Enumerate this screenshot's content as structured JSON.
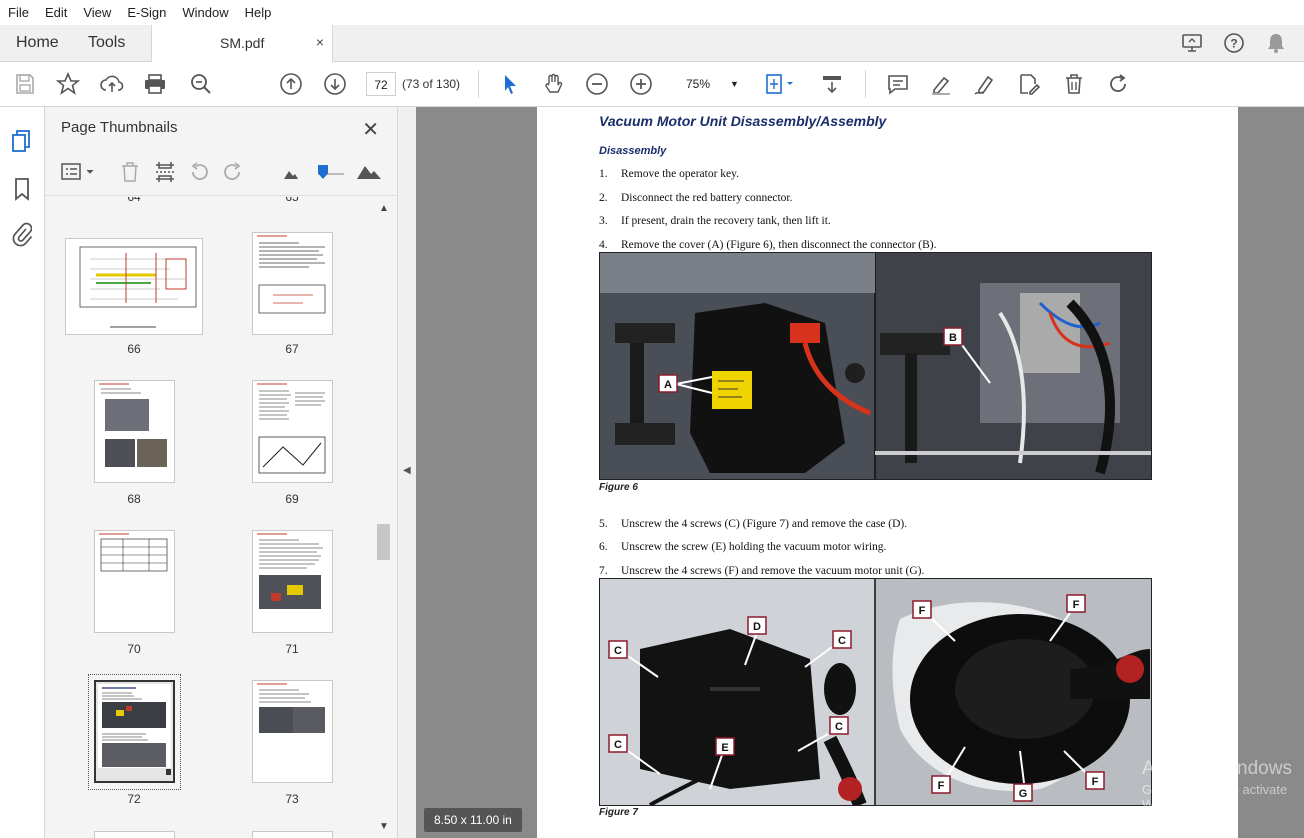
{
  "menu": [
    "File",
    "Edit",
    "View",
    "E-Sign",
    "Window",
    "Help"
  ],
  "tabs": {
    "home": "Home",
    "tools": "Tools",
    "doc": "SM.pdf",
    "close": "×"
  },
  "toolbar": {
    "page_input": "72",
    "page_count": "(73 of 130)",
    "zoom": "75%"
  },
  "panel": {
    "title": "Page Thumbnails",
    "close": "✕",
    "thumbnails": [
      {
        "label": "66"
      },
      {
        "label": "67"
      },
      {
        "label": "68"
      },
      {
        "label": "69"
      },
      {
        "label": "70"
      },
      {
        "label": "71"
      },
      {
        "label": "72",
        "selected": true
      },
      {
        "label": "73"
      }
    ],
    "partial_top": [
      "64",
      "65"
    ]
  },
  "document": {
    "heading": "Vacuum Motor Unit Disassembly/Assembly",
    "subheading": "Disassembly",
    "steps_a": [
      {
        "num": "1.",
        "text": "Remove the operator key."
      },
      {
        "num": "2.",
        "text": "Disconnect the red battery connector."
      },
      {
        "num": "3.",
        "text": "If present, drain the recovery tank, then lift it."
      },
      {
        "num": "4.",
        "text": "Remove the cover (A) (Figure 6), then disconnect the connector (B)."
      }
    ],
    "figure6_caption": "Figure 6",
    "figure6_labels": [
      "A",
      "B"
    ],
    "steps_b": [
      {
        "num": "5.",
        "text": "Unscrew the 4 screws (C) (Figure 7) and remove the case (D)."
      },
      {
        "num": "6.",
        "text": "Unscrew the screw (E) holding the vacuum motor wiring."
      },
      {
        "num": "7.",
        "text": "Unscrew the 4 screws (F) and remove the vacuum motor unit (G)."
      }
    ],
    "figure7_caption": "Figure 7",
    "figure7_labels": [
      "C",
      "D",
      "C",
      "C",
      "C",
      "E",
      "F",
      "F",
      "F",
      "G",
      "F"
    ]
  },
  "page_size": "8.50 x 11.00 in",
  "watermark": {
    "line1": "Activate Windows",
    "line2": "Go to Settings to activate Windows."
  },
  "colors": {
    "heading": "#1a2e6b",
    "callout_border": "#8b1a2b",
    "selected_thumb": "#333333"
  }
}
